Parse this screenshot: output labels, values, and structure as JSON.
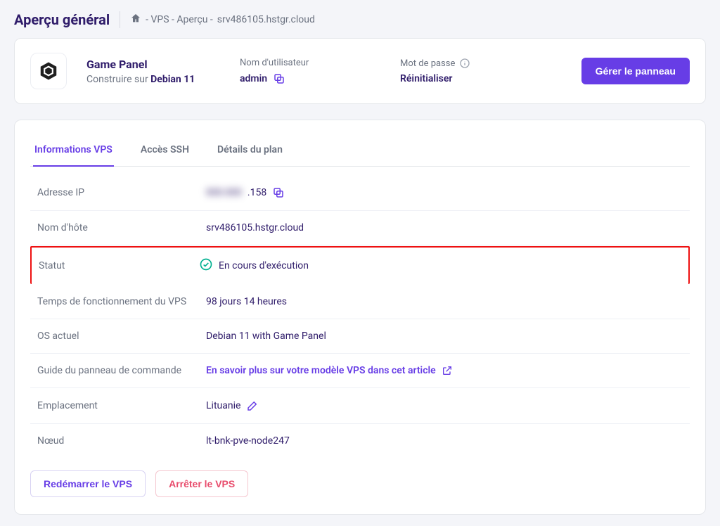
{
  "header": {
    "title": "Aperçu général",
    "breadcrumb_prefix": "- VPS - Aperçu -",
    "breadcrumb_host": "srv486105.hstgr.cloud"
  },
  "top": {
    "panel_title": "Game Panel",
    "built_on_prefix": "Construire sur ",
    "built_on_os": "Debian 11",
    "username_label": "Nom d'utilisateur",
    "username_value": "admin",
    "password_label": "Mot de passe",
    "password_action": "Réinitialiser",
    "manage_btn": "Gérer le panneau"
  },
  "tabs": [
    {
      "id": "info",
      "label": "Informations VPS",
      "active": true
    },
    {
      "id": "ssh",
      "label": "Accès SSH",
      "active": false
    },
    {
      "id": "plan",
      "label": "Détails du plan",
      "active": false
    }
  ],
  "info": {
    "ip_label": "Adresse IP",
    "ip_hidden": "000.000",
    "ip_suffix": ".158",
    "hostname_label": "Nom d'hôte",
    "hostname_value": "srv486105.hstgr.cloud",
    "status_label": "Statut",
    "status_value": "En cours d'exécution",
    "uptime_label": "Temps de fonctionnement du VPS",
    "uptime_value": "98 jours 14 heures",
    "os_label": "OS actuel",
    "os_value": "Debian 11 with Game Panel",
    "guide_label": "Guide du panneau de commande",
    "guide_link": "En savoir plus sur votre modèle VPS dans cet article",
    "location_label": "Emplacement",
    "location_value": "Lituanie",
    "node_label": "Nœud",
    "node_value": "lt-bnk-pve-node247"
  },
  "actions": {
    "restart": "Redémarrer le VPS",
    "stop": "Arrêter le VPS"
  }
}
